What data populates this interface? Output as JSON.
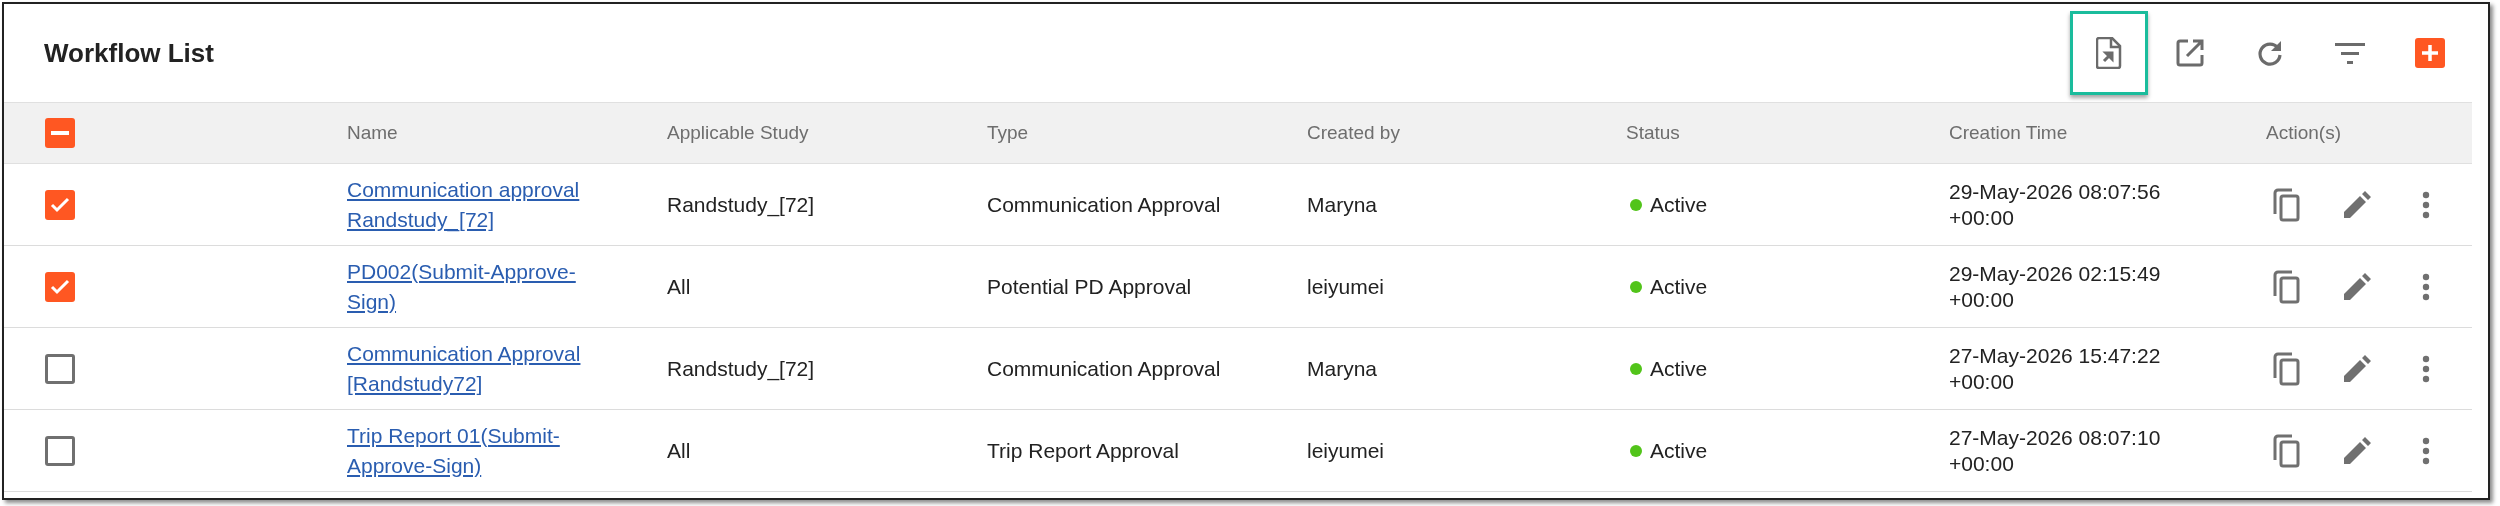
{
  "title": "Workflow List",
  "toolbar": [
    {
      "kind": "export-file",
      "highlighted": true
    },
    {
      "kind": "open-external",
      "highlighted": false
    },
    {
      "kind": "refresh",
      "highlighted": false
    },
    {
      "kind": "filter",
      "highlighted": false
    },
    {
      "kind": "add",
      "highlighted": false
    }
  ],
  "table": {
    "select_all": {
      "indeterminate": true
    },
    "columns": [
      "Name",
      "Applicable Study",
      "Type",
      "Created by",
      "Status",
      "Creation Time",
      "Action(s)"
    ],
    "rows": [
      {
        "checked": true,
        "name": "Communication approval Randstudy_[72]",
        "study": "Randstudy_[72]",
        "type": "Communication Approval",
        "created_by": "Maryna",
        "status": {
          "label": "Active",
          "color": "#52c41a"
        },
        "creation_time": "29-May-2026 08:07:56 +00:00"
      },
      {
        "checked": true,
        "name": "PD002(Submit-Approve-Sign)",
        "study": "All",
        "type": "Potential PD Approval",
        "created_by": "leiyumei",
        "status": {
          "label": "Active",
          "color": "#52c41a"
        },
        "creation_time": "29-May-2026 02:15:49 +00:00"
      },
      {
        "checked": false,
        "name": "Communication Approval [Randstudy72]",
        "study": "Randstudy_[72]",
        "type": "Communication Approval",
        "created_by": "Maryna",
        "status": {
          "label": "Active",
          "color": "#52c41a"
        },
        "creation_time": "27-May-2026 15:47:22 +00:00"
      },
      {
        "checked": false,
        "name": "Trip Report 01(Submit-Approve-Sign)",
        "study": "All",
        "type": "Trip Report Approval",
        "created_by": "leiyumei",
        "status": {
          "label": "Active",
          "color": "#52c41a"
        },
        "creation_time": "27-May-2026 08:07:10 +00:00"
      }
    ]
  }
}
